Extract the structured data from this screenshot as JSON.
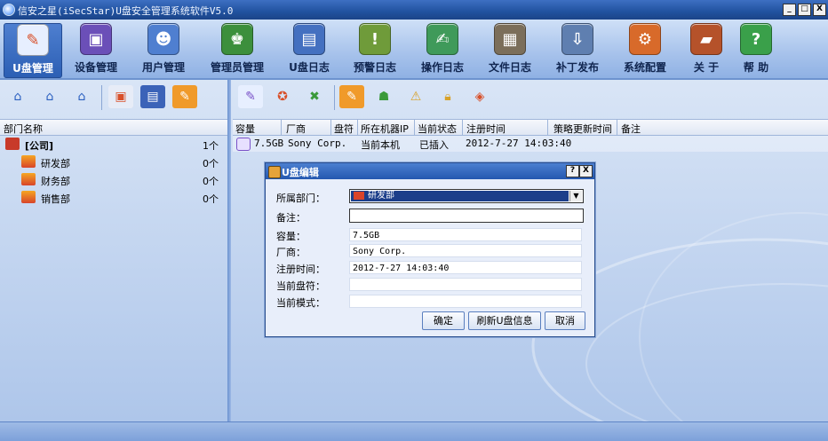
{
  "window": {
    "title": "信安之星(iSecStar)U盘安全管理系统软件V5.0",
    "btn_min": "_",
    "btn_max": "□",
    "btn_close": "X"
  },
  "toolbar": {
    "items": [
      {
        "label": "U盘管理",
        "icon": "usb-manage-icon",
        "color": "#d8e6ff"
      },
      {
        "label": "设备管理",
        "icon": "device-manage-icon",
        "color": "#6b4fb8"
      },
      {
        "label": "用户管理",
        "icon": "user-manage-icon",
        "color": "#4f7fd0"
      },
      {
        "label": "管理员管理",
        "icon": "admin-manage-icon",
        "color": "#3c8f3c"
      },
      {
        "label": "U盘日志",
        "icon": "usb-log-icon",
        "color": "#4470c0"
      },
      {
        "label": "预警日志",
        "icon": "alert-log-icon",
        "color": "#6f9b3a"
      },
      {
        "label": "操作日志",
        "icon": "operation-log-icon",
        "color": "#3f9a5a"
      },
      {
        "label": "文件日志",
        "icon": "file-log-icon",
        "color": "#7b6e5a"
      },
      {
        "label": "补丁发布",
        "icon": "patch-publish-icon",
        "color": "#5f7fb0"
      },
      {
        "label": "系统配置",
        "icon": "system-config-icon",
        "color": "#d86a2a"
      },
      {
        "label": "关 于",
        "icon": "about-icon",
        "color": "#b5522a"
      },
      {
        "label": "帮 助",
        "icon": "help-icon",
        "color": "#3aa04a"
      }
    ]
  },
  "tree": {
    "header": "部门名称",
    "items": [
      {
        "name": "[公司]",
        "count": "1个"
      },
      {
        "name": "研发部",
        "count": "0个"
      },
      {
        "name": "财务部",
        "count": "0个"
      },
      {
        "name": "销售部",
        "count": "0个"
      }
    ]
  },
  "grid": {
    "columns": [
      "容量",
      "厂商",
      "盘符",
      "所在机器IP",
      "当前状态",
      "注册时间",
      "策略更新时间",
      "备注"
    ],
    "rows": [
      {
        "capacity": "7.5GB",
        "vendor": "Sony Corp.",
        "drive": "",
        "ip": "当前本机",
        "status": "已插入",
        "reg_time": "2012-7-27 14:03:40",
        "policy_time": "",
        "note": ""
      }
    ]
  },
  "dialog": {
    "title": "U盘编辑",
    "help": "?",
    "close": "X",
    "fields": {
      "dept_label": "所属部门：",
      "dept_value": "研发部",
      "note_label": "备注：",
      "note_value": "",
      "capacity_label": "容量：",
      "capacity_value": "7.5GB",
      "vendor_label": "厂商：",
      "vendor_value": "Sony Corp.",
      "reg_label": "注册时间：",
      "reg_value": "2012-7-27 14:03:40",
      "drive_label": "当前盘符：",
      "drive_value": "",
      "mode_label": "当前模式：",
      "mode_value": ""
    },
    "buttons": {
      "ok": "确定",
      "refresh": "刷新U盘信息",
      "cancel": "取消"
    }
  }
}
